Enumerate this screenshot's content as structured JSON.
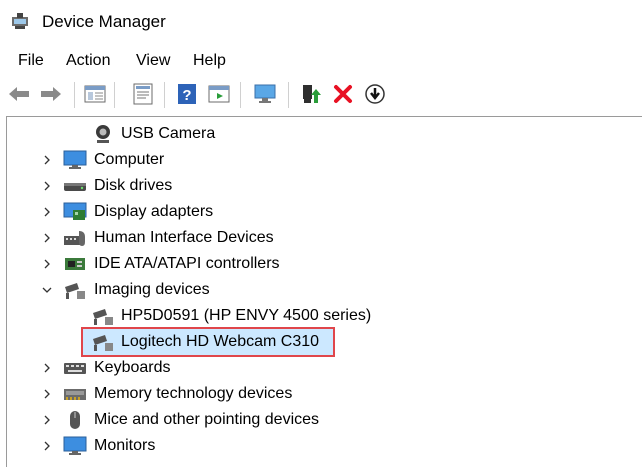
{
  "window": {
    "title": "Device Manager"
  },
  "menu": [
    "File",
    "Action",
    "View",
    "Help"
  ],
  "toolbar": {
    "buttons": [
      "back-arrow-icon",
      "forward-arrow-icon",
      "show-hide-console-tree-icon",
      "properties-icon",
      "help-icon",
      "run-icon",
      "scan-hardware-icon",
      "update-driver-icon",
      "uninstall-device-icon",
      "disable-device-icon"
    ]
  },
  "tree": {
    "rows": [
      {
        "label": "USB Camera",
        "icon": "webcam-icon",
        "level": 1,
        "expander": "none"
      },
      {
        "label": "Computer",
        "icon": "monitor-icon",
        "level": 0,
        "expander": "collapsed"
      },
      {
        "label": "Disk drives",
        "icon": "disk-drive-icon",
        "level": 0,
        "expander": "collapsed"
      },
      {
        "label": "Display adapters",
        "icon": "display-adapter-icon",
        "level": 0,
        "expander": "collapsed"
      },
      {
        "label": "Human Interface Devices",
        "icon": "hid-icon",
        "level": 0,
        "expander": "collapsed"
      },
      {
        "label": "IDE ATA/ATAPI controllers",
        "icon": "controller-icon",
        "level": 0,
        "expander": "collapsed"
      },
      {
        "label": "Imaging devices",
        "icon": "camera-icon",
        "level": 0,
        "expander": "expanded"
      },
      {
        "label": "HP5D0591 (HP ENVY 4500 series)",
        "icon": "camera-icon",
        "level": 1,
        "expander": "none"
      },
      {
        "label": "Logitech HD Webcam C310",
        "icon": "camera-icon",
        "level": 1,
        "expander": "none",
        "selected": true
      },
      {
        "label": "Keyboards",
        "icon": "keyboard-icon",
        "level": 0,
        "expander": "collapsed"
      },
      {
        "label": "Memory technology devices",
        "icon": "memory-card-icon",
        "level": 0,
        "expander": "collapsed"
      },
      {
        "label": "Mice and other pointing devices",
        "icon": "mouse-icon",
        "level": 0,
        "expander": "collapsed"
      },
      {
        "label": "Monitors",
        "icon": "monitor-icon",
        "level": 0,
        "expander": "collapsed"
      }
    ]
  },
  "colors": {
    "selection": "#cce8ff",
    "highlight_border": "#e0464b",
    "uninstall": "#e81123",
    "update": "#2a9d3a"
  }
}
